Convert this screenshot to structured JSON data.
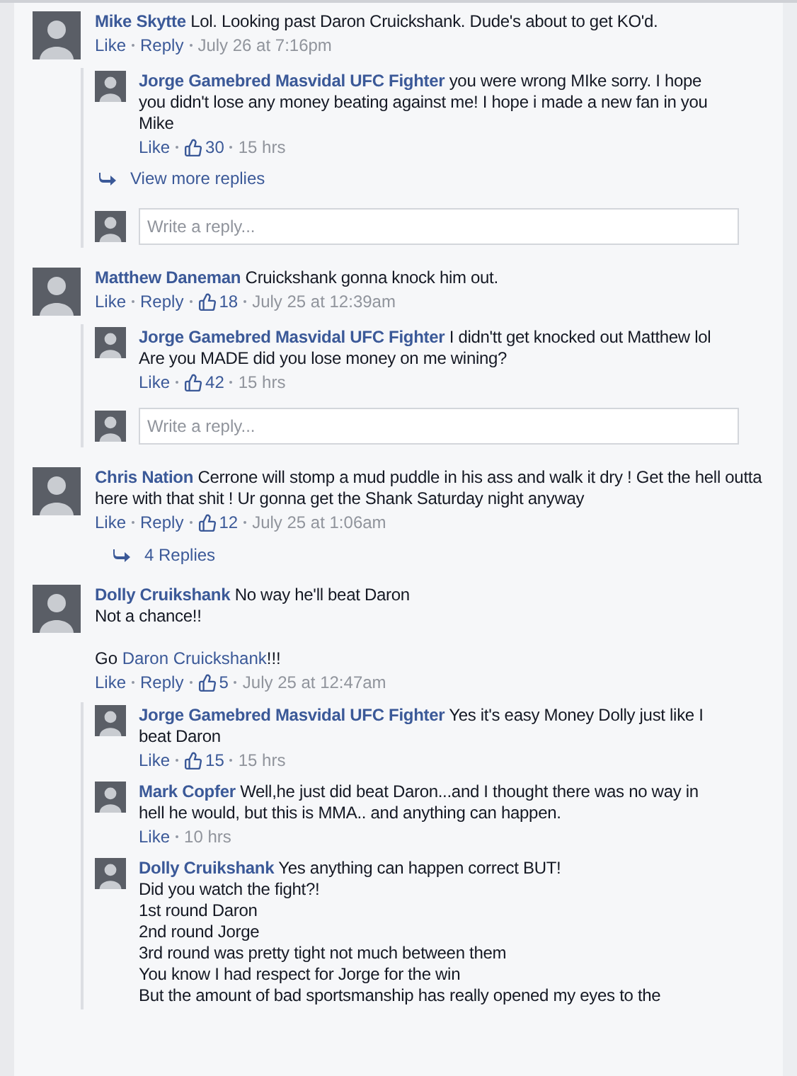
{
  "comments": [
    {
      "author": "Mike Skytte",
      "text": "Lol. Looking past Daron Cruickshank. Dude's about to get KO'd.",
      "like_label": "Like",
      "reply_label": "Reply",
      "time": "July 26 at 7:16pm",
      "replies": [
        {
          "author": "Jorge Gamebred Masvidal UFC Fighter",
          "text": "you were wrong MIke sorry. I hope you didn't lose any money beating against me! I hope i made a new fan in you Mike",
          "like_label": "Like",
          "likes": "30",
          "time": "15 hrs"
        }
      ],
      "more_replies": "View more replies",
      "reply_box": {
        "placeholder": "Write a reply..."
      }
    },
    {
      "author": "Matthew Daneman",
      "text": "Cruickshank gonna knock him out.",
      "like_label": "Like",
      "reply_label": "Reply",
      "likes": "18",
      "time": "July 25 at 12:39am",
      "replies": [
        {
          "author": "Jorge Gamebred Masvidal UFC Fighter",
          "text": "I didn'tt get knocked out Matthew lol Are you MADE did you lose money on me wining?",
          "like_label": "Like",
          "likes": "42",
          "time": "15 hrs"
        }
      ],
      "reply_box": {
        "placeholder": "Write a reply..."
      }
    },
    {
      "author": "Chris Nation",
      "text": "Cerrone will stomp a mud puddle in his ass and walk it dry ! Get the hell outta here with that shit ! Ur gonna get the Shank Saturday night anyway",
      "like_label": "Like",
      "reply_label": "Reply",
      "likes": "12",
      "time": "July 25 at 1:06am",
      "more_replies": "4 Replies"
    },
    {
      "author": "Dolly Cruikshank",
      "text": "No way he'll beat Daron\nNot a chance!!",
      "extra": {
        "before": "Go ",
        "link": "Daron Cruickshank",
        "after": "!!!"
      },
      "like_label": "Like",
      "reply_label": "Reply",
      "likes": "5",
      "time": "July 25 at 12:47am",
      "replies": [
        {
          "author": "Jorge Gamebred Masvidal UFC Fighter",
          "text": "Yes it's easy Money Dolly just like I beat Daron",
          "like_label": "Like",
          "likes": "15",
          "time": "15 hrs"
        },
        {
          "author": "Mark Copfer",
          "text": "Well,he just did beat Daron...and I thought there was no way in hell he would, but this is MMA.. and anything can happen.",
          "like_label": "Like",
          "time": "10 hrs"
        },
        {
          "author": "Dolly Cruikshank",
          "text": "Yes anything can happen correct BUT!\nDid you watch the fight?!\n1st round Daron\n2nd round Jorge\n3rd round was pretty tight not much between them\nYou know I had respect for Jorge for the win\nBut the amount of bad sportsmanship has really opened my eyes to the"
        }
      ]
    }
  ]
}
